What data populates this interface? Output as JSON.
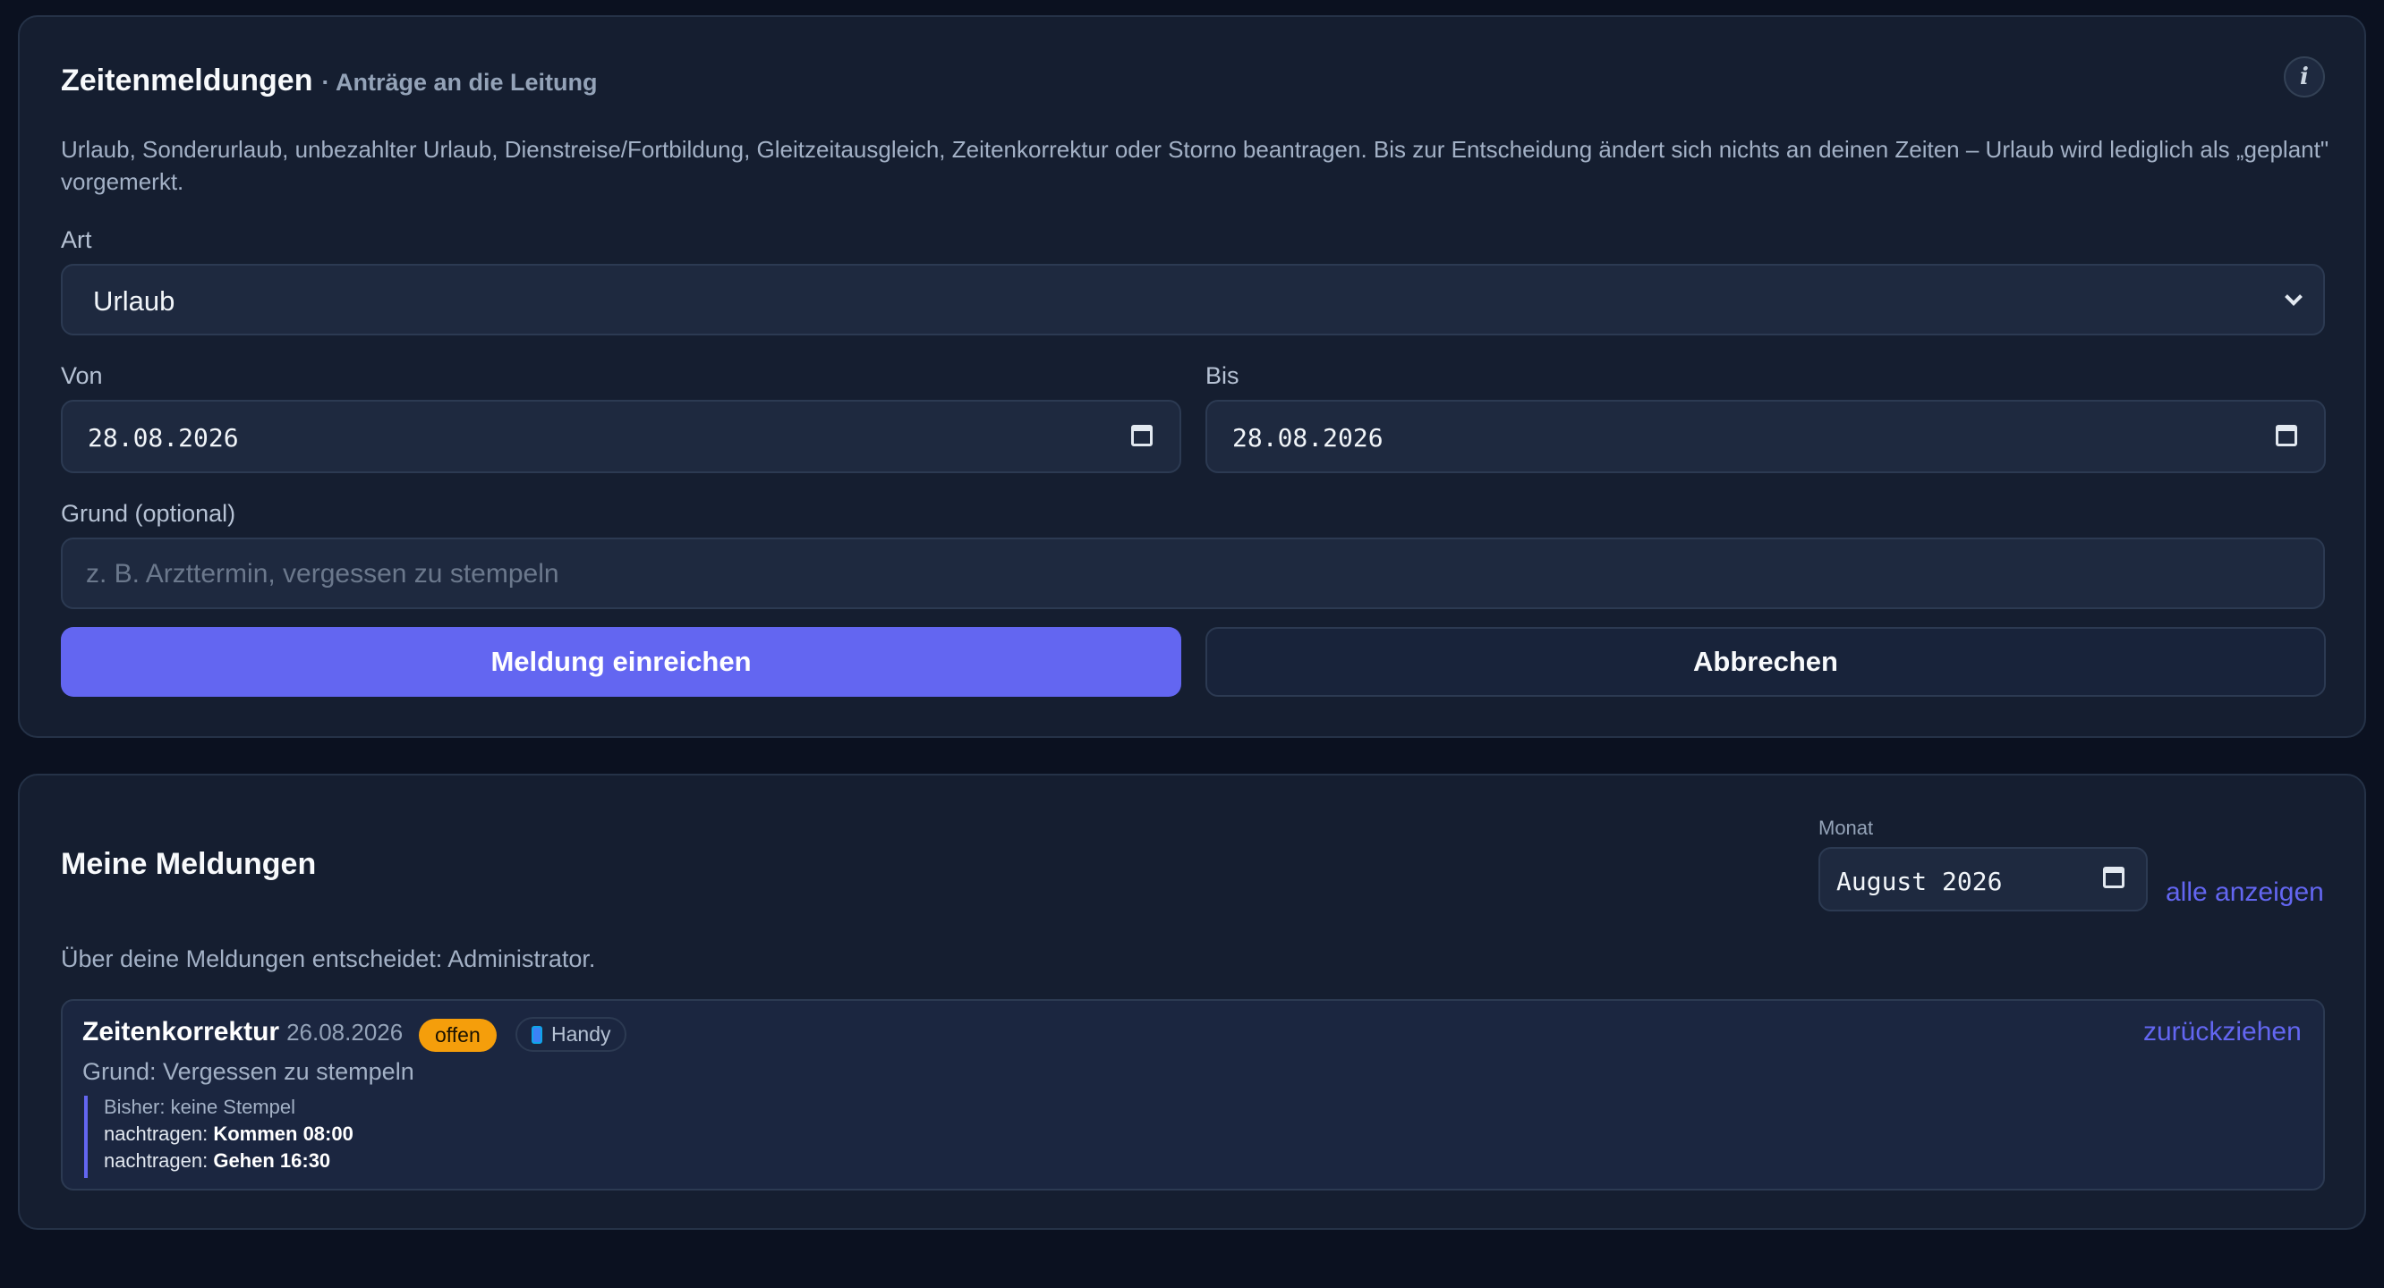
{
  "request_form": {
    "title": "Zeitenmeldungen",
    "subtitle": "· Anträge an die Leitung",
    "info_label": "i",
    "description": "Urlaub, Sonderurlaub, unbezahlter Urlaub, Dienstreise/Fortbildung, Gleitzeitausgleich, Zeitenkorrektur oder Storno beantragen. Bis zur Entscheidung ändert sich nichts an deinen Zeiten – Urlaub wird lediglich als „geplant\" vorgemerkt.",
    "type_label": "Art",
    "type_value": "Urlaub",
    "from_label": "Von",
    "from_value": "28.08.2026",
    "to_label": "Bis",
    "to_value": "28.08.2026",
    "reason_label": "Grund (optional)",
    "reason_placeholder": "z. B. Arzttermin, vergessen zu stempeln",
    "submit_label": "Meldung einreichen",
    "cancel_label": "Abbrechen"
  },
  "my_requests": {
    "title": "Meine Meldungen",
    "month_label": "Monat",
    "month_value": "August 2026",
    "show_all_label": "alle anzeigen",
    "decider_text": "Über deine Meldungen entscheidet: Administrator.",
    "items": [
      {
        "type": "Zeitenkorrektur",
        "date": "26.08.2026",
        "status": "offen",
        "device": "Handy",
        "withdraw_label": "zurückziehen",
        "reason": "Grund: Vergessen zu stempeln",
        "previous": "Bisher: keine Stempel",
        "add_prefix_1": "nachtragen:",
        "add_value_1": "Kommen 08:00",
        "add_prefix_2": "nachtragen:",
        "add_value_2": "Gehen 16:30"
      }
    ]
  },
  "colors": {
    "accent": "#6366f1",
    "status_open": "#f59e0b",
    "background": "#0b1120",
    "card": "#151e30"
  }
}
